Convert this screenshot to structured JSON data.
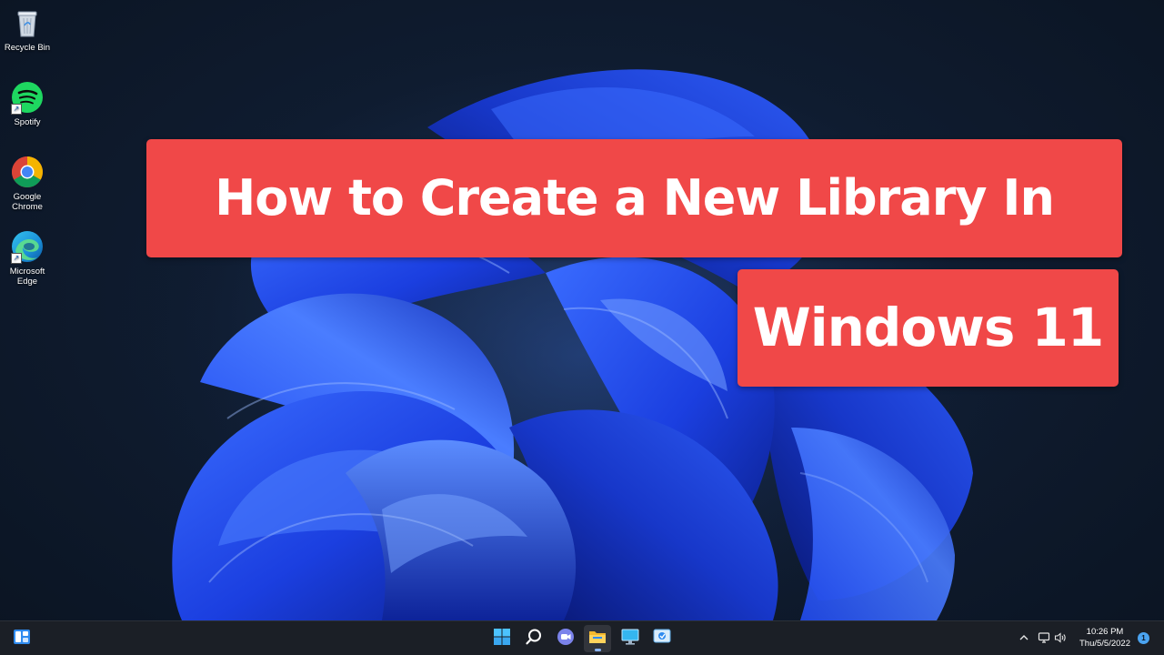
{
  "desktop": {
    "icons": [
      {
        "label": "Recycle Bin",
        "icon": "recycle-bin-icon"
      },
      {
        "label": "Spotify",
        "icon": "spotify-icon"
      },
      {
        "label": "Google Chrome",
        "icon": "chrome-icon"
      },
      {
        "label": "Microsoft Edge",
        "icon": "edge-icon"
      }
    ]
  },
  "overlay": {
    "line1": "How to Create a New Library In",
    "line2": "Windows 11",
    "color": "#f04848"
  },
  "taskbar": {
    "items": [
      {
        "icon": "widgets-icon"
      },
      {
        "icon": "start-icon"
      },
      {
        "icon": "search-icon"
      },
      {
        "icon": "teams-chat-icon"
      },
      {
        "icon": "file-explorer-icon",
        "active": true
      },
      {
        "icon": "desktop-monitor-icon"
      },
      {
        "icon": "control-panel-icon"
      }
    ],
    "tray": {
      "clock_time": "10:26 PM",
      "clock_date": "Thu/5/5/2022",
      "notification_count": "1"
    }
  }
}
